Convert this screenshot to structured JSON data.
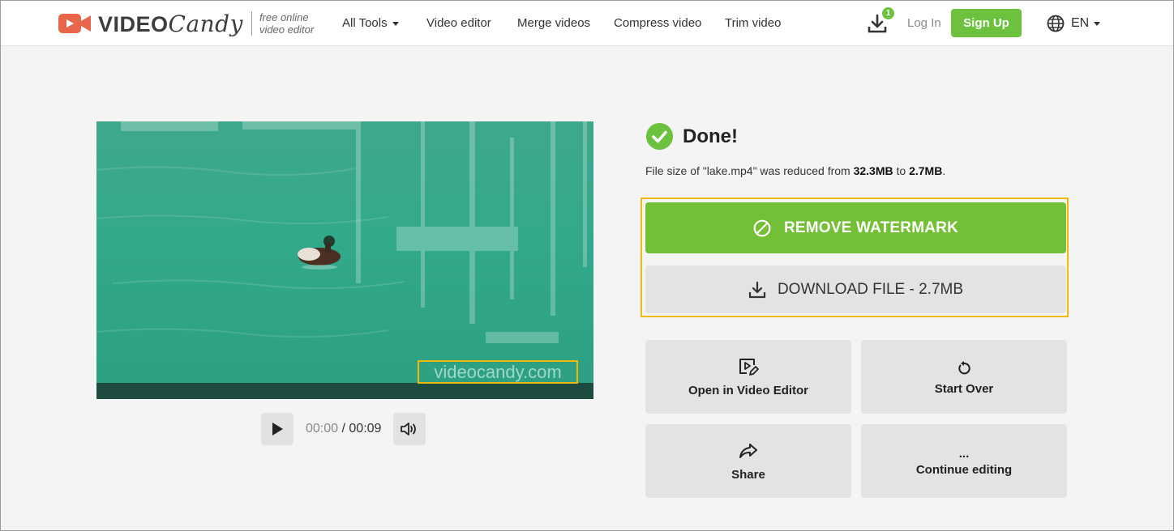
{
  "header": {
    "logo_video": "VIDEO",
    "logo_candy": "Candy",
    "logo_tag_line1": "free online",
    "logo_tag_line2": "video editor",
    "nav": [
      "All Tools",
      "Video editor",
      "Merge videos",
      "Compress video",
      "Trim video"
    ],
    "download_badge": "1",
    "login": "Log In",
    "signup": "Sign Up",
    "language": "EN"
  },
  "video": {
    "watermark": "videocandy.com",
    "current_time": "00:00",
    "separator": "/",
    "total_time": "00:09"
  },
  "result": {
    "title": "Done!",
    "summary_prefix": "File size of \"lake.mp4\" was reduced from ",
    "size_from": "32.3MB",
    "summary_mid": " to ",
    "size_to": "2.7MB",
    "summary_end": "."
  },
  "actions": {
    "remove_watermark": "REMOVE WATERMARK",
    "download": "DOWNLOAD FILE - 2.7MB",
    "open_editor": "Open in Video Editor",
    "start_over": "Start Over",
    "share": "Share",
    "continue_icon": "...",
    "continue_editing": "Continue editing"
  },
  "colors": {
    "brand_green": "#6cc13f",
    "highlight_yellow": "#f0b90b",
    "logo_orange": "#e8674a"
  }
}
